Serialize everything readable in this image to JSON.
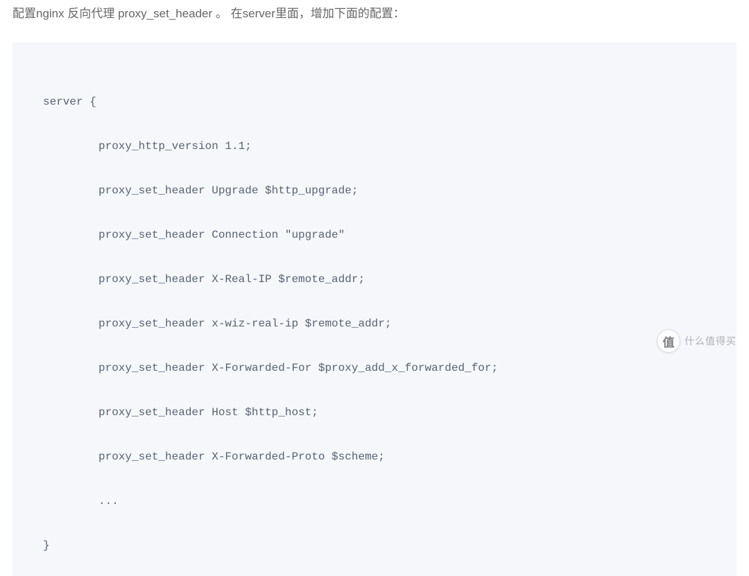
{
  "description": "配置nginx 反向代理 proxy_set_header 。 在server里面，增加下面的配置：",
  "code": {
    "lines": [
      {
        "text": "server {",
        "indent": 0
      },
      {
        "text": "proxy_http_version 1.1;",
        "indent": 1
      },
      {
        "text": "proxy_set_header Upgrade $http_upgrade;",
        "indent": 1
      },
      {
        "text": "proxy_set_header Connection \"upgrade\"",
        "indent": 1
      },
      {
        "text": "proxy_set_header X-Real-IP $remote_addr;",
        "indent": 1
      },
      {
        "text": "proxy_set_header x-wiz-real-ip $remote_addr;",
        "indent": 1
      },
      {
        "text": "proxy_set_header X-Forwarded-For $proxy_add_x_forwarded_for;",
        "indent": 1
      },
      {
        "text": "proxy_set_header Host $http_host;",
        "indent": 1
      },
      {
        "text": "proxy_set_header X-Forwarded-Proto $scheme;",
        "indent": 1
      },
      {
        "text": "...",
        "indent": 1
      },
      {
        "text": "}",
        "indent": 0
      }
    ]
  },
  "watermark": {
    "symbol": "值",
    "text": "什么值得买"
  }
}
